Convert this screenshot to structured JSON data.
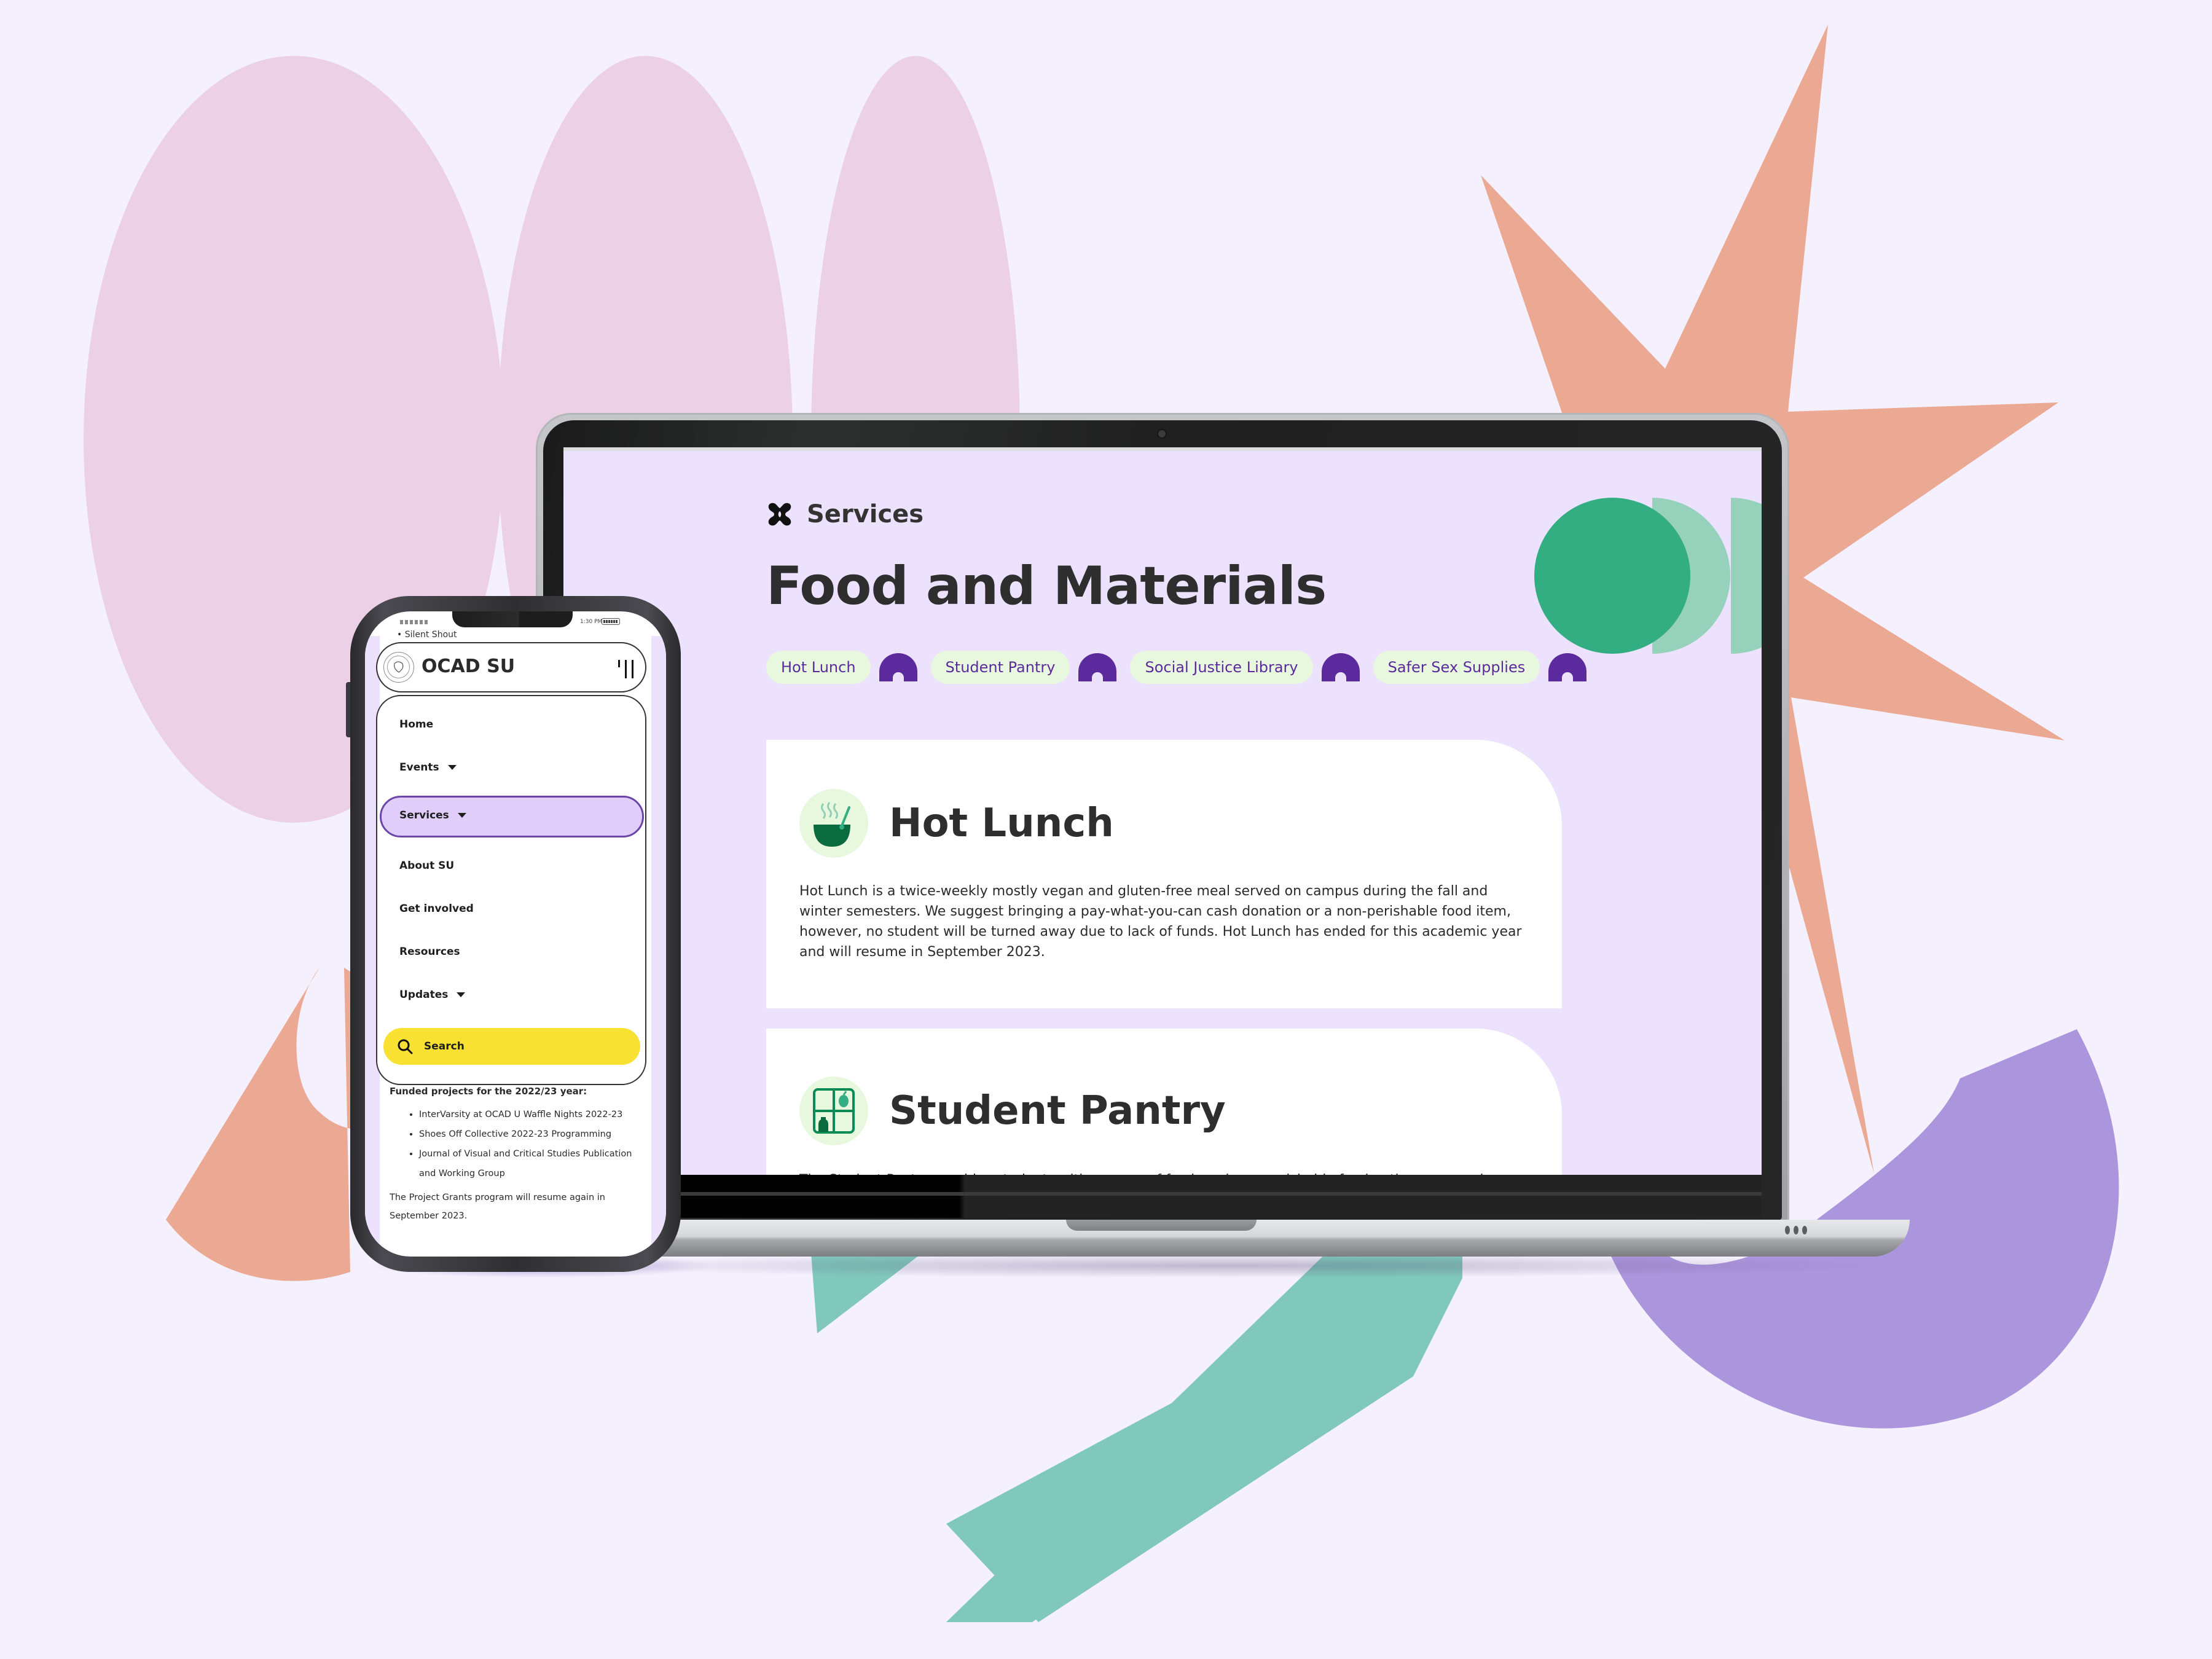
{
  "colors": {
    "background": "#f4f0fd",
    "screen_bg": "#ece2fd",
    "accent_purple": "#5b2a9c",
    "green_primary": "#33ad82",
    "green_light": "#95d1bb",
    "tag_bg": "#e8f8df",
    "search_yellow": "#f9e133",
    "nav_active_bg": "#e1cdfa",
    "shape_pink": "#ecd0e6",
    "shape_salmon": "#eba893",
    "shape_teal": "#80c8bb",
    "shape_lavender": "#ab95dc"
  },
  "laptop": {
    "breadcrumb": {
      "icon": "services-flower-icon",
      "label": "Services"
    },
    "page_title": "Food and Materials",
    "tags": [
      {
        "label": "Hot Lunch"
      },
      {
        "label": "Student Pantry"
      },
      {
        "label": "Social Justice Library"
      },
      {
        "label": "Safer Sex Supplies"
      }
    ],
    "cards": [
      {
        "icon": "soup-bowl-icon",
        "title": "Hot Lunch",
        "text": "Hot Lunch is a twice-weekly mostly vegan and gluten-free meal served on campus during the fall and winter semesters. We suggest bringing a pay-what-you-can cash donation or a non-perishable food item, however, no student will be turned away due to lack of funds. Hot Lunch has ended for this academic year and will resume in September 2023."
      },
      {
        "icon": "pantry-shelf-icon",
        "title": "Student Pantry",
        "text": "The Student Pantry provides students with a range of fresh and non-perishable food options, premade meals and"
      }
    ]
  },
  "phone": {
    "status_time": "1:30 PM",
    "scrolled_text": "Silent Shout",
    "brand": "OCAD SU",
    "nav": [
      {
        "label": "Home",
        "has_dropdown": false
      },
      {
        "label": "Events",
        "has_dropdown": true
      },
      {
        "label": "Services",
        "has_dropdown": true,
        "active": true
      },
      {
        "label": "About SU",
        "has_dropdown": false
      },
      {
        "label": "Get involved",
        "has_dropdown": false
      },
      {
        "label": "Resources",
        "has_dropdown": false
      },
      {
        "label": "Updates",
        "has_dropdown": true
      }
    ],
    "search_label": "Search",
    "content": {
      "heading": "Funded projects for the 2022/23 year:",
      "items": [
        "InterVarsity at OCAD U Waffle Nights 2022-23",
        "Shoes Off Collective 2022-23 Programming",
        "Journal of Visual and Critical Studies Publication and Working Group"
      ],
      "footer": "The Project Grants program will resume again in September 2023."
    }
  }
}
